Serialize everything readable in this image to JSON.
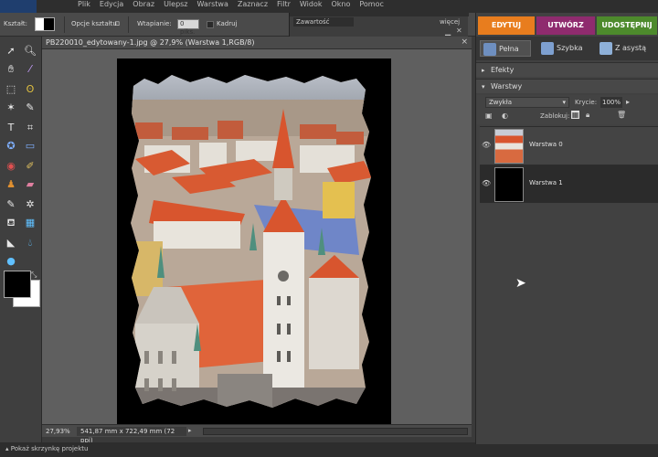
{
  "menubar": {
    "items": [
      "Plik",
      "Edycja",
      "Obraz",
      "Ulepsz",
      "Warstwa",
      "Zaznacz",
      "Filtr",
      "Widok",
      "Okno",
      "Pomoc"
    ]
  },
  "options": {
    "shape_label": "Kształt:",
    "shape_options_label": "Opcje kształtu:",
    "feather_label": "Wtapianie:",
    "feather_value": "0 piks.",
    "crop_label": "Kadruj"
  },
  "bin": {
    "tab_label": "Zawartość",
    "view_label": "więcej"
  },
  "document": {
    "title": "PB220010_edytowany-1.jpg @ 27,9% (Warstwa 1,RGB/8)",
    "close_label": "×"
  },
  "status": {
    "zoom": "27,93%",
    "docsize": "541,87 mm x 722,49 mm (72 ppi)",
    "arrow": "▸"
  },
  "bottom": {
    "bin_toggle": "Pokaż skrzynkę projektu"
  },
  "mode_tabs": [
    {
      "label": "EDYTUJ",
      "color": "#e87d1e"
    },
    {
      "label": "UTWÓRZ",
      "color": "#8f2b6e"
    },
    {
      "label": "UDOSTĘPNIJ",
      "color": "#4d8a2c"
    }
  ],
  "edit_tabs": [
    {
      "label": "Pełna"
    },
    {
      "label": "Szybka"
    },
    {
      "label": "Z asystą"
    }
  ],
  "panels": {
    "effects_label": "Efekty",
    "layers_label": "Warstwy"
  },
  "layers": {
    "blend_mode": "Zwykła",
    "opacity_label": "Krycie:",
    "opacity_value": "100%",
    "lock_label": "Zablokuj:",
    "items": [
      {
        "name": "Warstwa 0",
        "thumb": "photo"
      },
      {
        "name": "Warstwa 1",
        "thumb": "black"
      }
    ]
  },
  "colors": {
    "foreground": "#000000",
    "background": "#ffffff"
  },
  "icons": [
    "move-icon",
    "zoom-icon",
    "hand-icon",
    "eyedropper-icon",
    "marquee-icon",
    "lasso-icon",
    "magic-wand-icon",
    "quick-selection-icon",
    "type-icon",
    "crop-icon",
    "cookie-cutter-icon",
    "straighten-icon",
    "red-eye-icon",
    "spot-healing-icon",
    "clone-stamp-icon",
    "eraser-icon",
    "brush-icon",
    "smart-brush-icon",
    "paint-bucket-icon",
    "gradient-icon",
    "shape-icon",
    "blur-icon",
    "sponge-icon"
  ]
}
